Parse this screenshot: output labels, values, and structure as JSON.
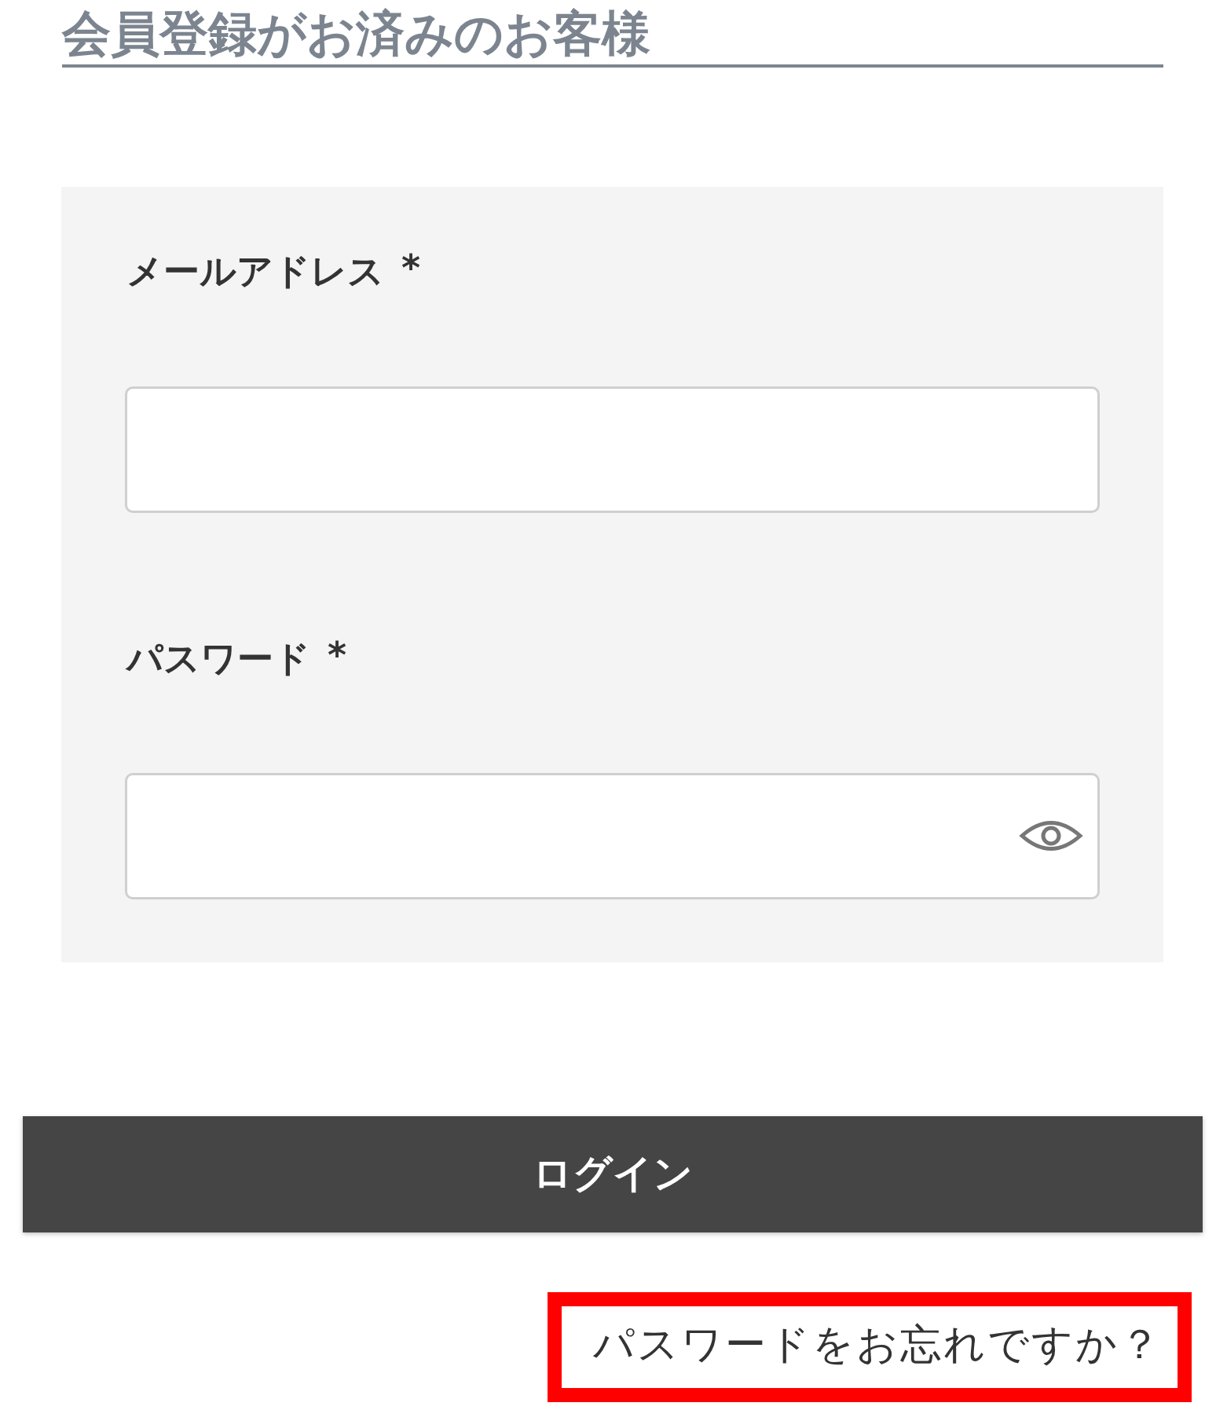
{
  "heading": "会員登録がお済みのお客様",
  "fields": [
    {
      "label": "メールアドレス",
      "required_mark": "*",
      "kind": "text"
    },
    {
      "label": "パスワード",
      "required_mark": "*",
      "kind": "password"
    }
  ],
  "login_button": "ログイン",
  "forgot_link": {
    "text": "パスワードをお忘れですか？",
    "highlighted": true
  }
}
